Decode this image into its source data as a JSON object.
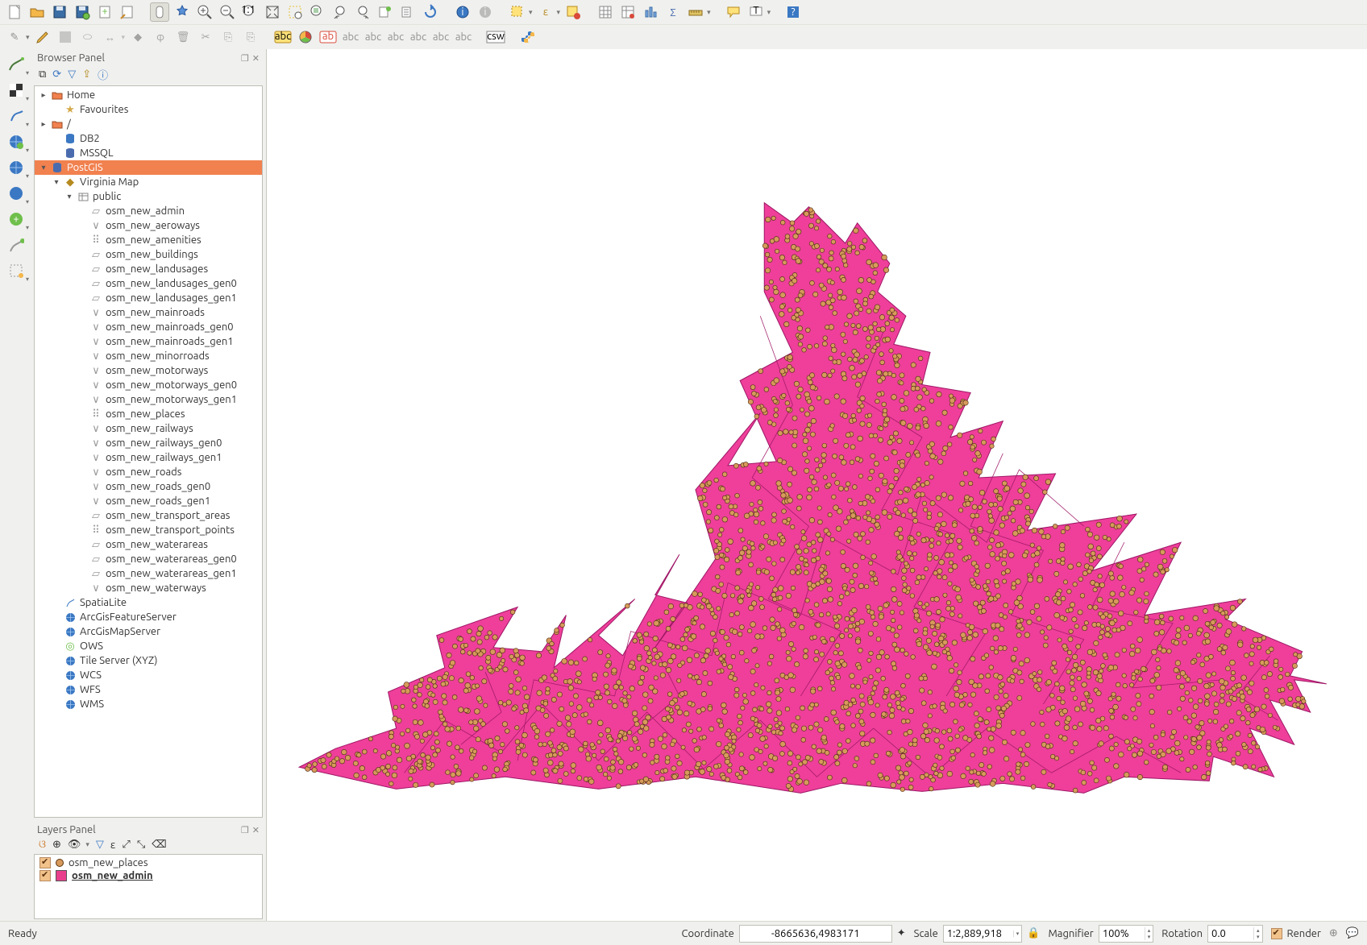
{
  "panels": {
    "browser_title": "Browser Panel",
    "layers_title": "Layers Panel"
  },
  "browser_tree": {
    "home": "Home",
    "favourites": "Favourites",
    "root": "/",
    "db2": "DB2",
    "mssql": "MSSQL",
    "postgis": "PostGIS",
    "conn": "Virginia Map",
    "schema": "public",
    "tables": [
      "osm_new_admin",
      "osm_new_aeroways",
      "osm_new_amenities",
      "osm_new_buildings",
      "osm_new_landusages",
      "osm_new_landusages_gen0",
      "osm_new_landusages_gen1",
      "osm_new_mainroads",
      "osm_new_mainroads_gen0",
      "osm_new_mainroads_gen1",
      "osm_new_minorroads",
      "osm_new_motorways",
      "osm_new_motorways_gen0",
      "osm_new_motorways_gen1",
      "osm_new_places",
      "osm_new_railways",
      "osm_new_railways_gen0",
      "osm_new_railways_gen1",
      "osm_new_roads",
      "osm_new_roads_gen0",
      "osm_new_roads_gen1",
      "osm_new_transport_areas",
      "osm_new_transport_points",
      "osm_new_waterareas",
      "osm_new_waterareas_gen0",
      "osm_new_waterareas_gen1",
      "osm_new_waterways"
    ],
    "providers": [
      "SpatiaLite",
      "ArcGisFeatureServer",
      "ArcGisMapServer",
      "OWS",
      "Tile Server (XYZ)",
      "WCS",
      "WFS",
      "WMS"
    ]
  },
  "layers": [
    {
      "name": "osm_new_places",
      "swatch": "#d79a5b",
      "shape": "dot",
      "bold": false
    },
    {
      "name": "osm_new_admin",
      "swatch": "#e83e8c",
      "shape": "square",
      "bold": true
    }
  ],
  "status": {
    "ready": "Ready",
    "coord_label": "Coordinate",
    "coord_value": "-8665636,4983171",
    "scale_label": "Scale",
    "scale_value": "1:2,889,918",
    "mag_label": "Magnifier",
    "mag_value": "100%",
    "rot_label": "Rotation",
    "rot_value": "0.0",
    "render_label": "Render"
  },
  "colors": {
    "select": "#f1814f",
    "admin_fill": "#ef3f9a",
    "admin_stroke": "#9e1766",
    "place_fill": "#d79a5b",
    "place_stroke": "#4a2a10"
  },
  "geom_icons": {
    "poly": "▱",
    "line": "∨",
    "point": "⠿"
  }
}
